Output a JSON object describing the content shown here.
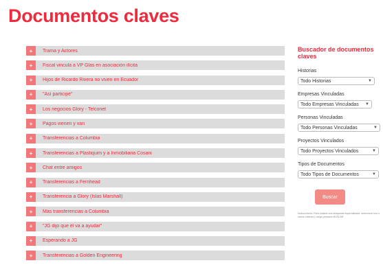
{
  "page": {
    "title": "Documentos claves"
  },
  "documents": [
    "Trama y Actores",
    "Fiscal vincula a VP Glas en asociación ilícita",
    "Hijos de Ricardo Rivera no viven en Ecuador",
    "\"Así participé\"",
    "Los negocios Glory - Telconet",
    "Pagos vienen y van",
    "Transferencias a Columbia",
    "Transferencias a Plastiquim y a Inmobiliaria Cosani",
    "Chat entre amigos",
    "Transferencias a Fernhead",
    "Transferencia a Glory (Islas Marshall)",
    "Más transferencias a Columbia",
    "\"JG dijo que él va a ayudar\"",
    "Esperando a JG",
    "Transferencias a Golden Engineering"
  ],
  "sidebar": {
    "title": "Buscador de documentos claves",
    "filters": [
      {
        "label": "Historias",
        "selected": "Todo Historias"
      },
      {
        "label": "Empresas Vinculadas",
        "selected": "Todo Empresas Vinculadas"
      },
      {
        "label": "Personas Vinculadas",
        "selected": "Todo Personas Vinculadas"
      },
      {
        "label": "Proyectos Vinculados",
        "selected": "Todo Proyectos Vinculados"
      },
      {
        "label": "Tipos de Documentos",
        "selected": "Todo Tipos de Documentos"
      }
    ],
    "button_label": "Buscar",
    "help_text": "Instrucciones: Para realizar una búsqueda especializada, seleccione uno o varios criterios y luego presione BUSCAR"
  },
  "colors": {
    "accent": "#ee2a3c",
    "plus_button": "#f2767a",
    "row_bg": "#dcdcdc",
    "search_button": "#f28b86"
  },
  "icons": {
    "row_icon": "plus-icon",
    "select_icon": "chevron-down-icon"
  }
}
